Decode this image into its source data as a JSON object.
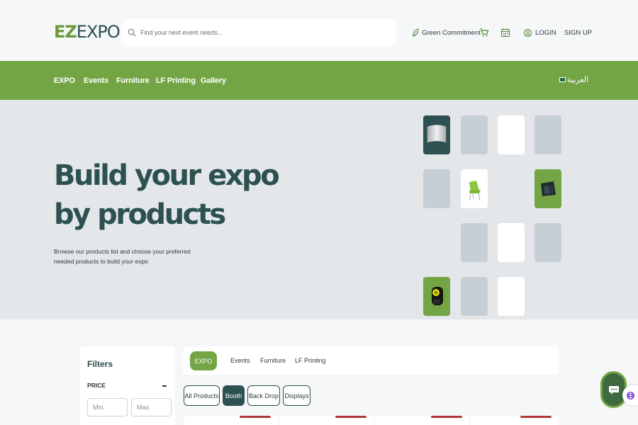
{
  "header": {
    "logo_ez": "EZ",
    "logo_expo": "EXPO",
    "search_placeholder": "Find your next event needs...",
    "green_commitment": "Green Commitment",
    "login": "LOGIN",
    "signup": "SIGN UP"
  },
  "nav": {
    "items": [
      "EXPO",
      "Events",
      "Furniture",
      "LF Printing",
      "Gallery"
    ],
    "language": "العربية"
  },
  "hero": {
    "title_line1": "Build your expo",
    "title_line2": "by products",
    "subtitle": "Browse our products list and choose your preferred needed products to build your expo"
  },
  "filters": {
    "title": "Filters",
    "price_label": "PRICE",
    "min_placeholder": "Min.",
    "max_placeholder": "Max."
  },
  "categories": [
    "EXPO",
    "Events",
    "Furniture",
    "LF Printing"
  ],
  "active_category": "EXPO",
  "subtabs": [
    "All Products",
    "Booth",
    "Back Drop",
    "Displays"
  ],
  "active_subtab": "Booth",
  "colors": {
    "brand_green": "#74a545",
    "brand_teal": "#2d5050",
    "hero_bg": "#e3e7ea",
    "tile_gray": "#c7cfd6"
  }
}
